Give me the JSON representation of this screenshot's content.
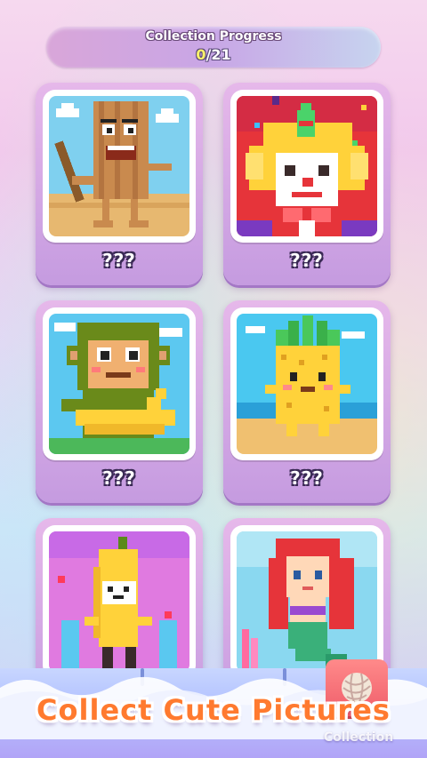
{
  "progress": {
    "title": "Collection Progress",
    "current": "0",
    "total": "/21"
  },
  "cards": [
    {
      "label": "???",
      "picture": "wooden-plank-character"
    },
    {
      "label": "???",
      "picture": "clown"
    },
    {
      "label": "???",
      "picture": "monkey-with-banana"
    },
    {
      "label": "???",
      "picture": "pineapple-character"
    },
    {
      "label": "???",
      "picture": "banana-character"
    },
    {
      "label": "???",
      "picture": "mermaid"
    }
  ],
  "banner": {
    "text": "Collect Cute Pictures"
  },
  "nav": {
    "collection_label": "Collection",
    "icon": "yarn-ball-icon"
  },
  "colors": {
    "banner": "#ff7a2f",
    "card": "#d7a9e6",
    "progress_current": "#fff36b"
  }
}
